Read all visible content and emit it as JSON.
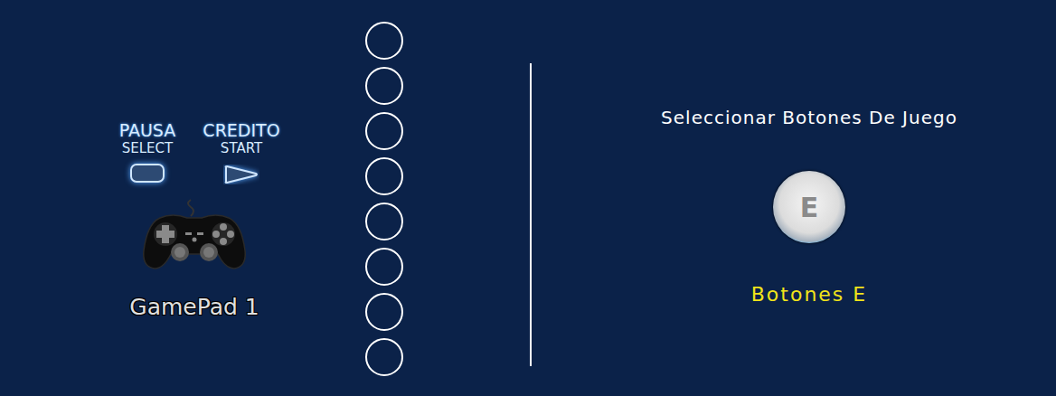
{
  "controller": {
    "pause_label": "PAUSA",
    "credit_label": "CREDITO",
    "select_label": "SELECT",
    "start_label": "START",
    "name": "GamePad 1"
  },
  "slots": [
    {
      "filled": false
    },
    {
      "filled": false
    },
    {
      "filled": false
    },
    {
      "filled": false
    },
    {
      "filled": false
    },
    {
      "filled": false
    },
    {
      "filled": false
    },
    {
      "filled": false
    }
  ],
  "selector": {
    "title": "Seleccionar Botones De Juego",
    "button_letter": "E",
    "caption": "Botones E"
  }
}
